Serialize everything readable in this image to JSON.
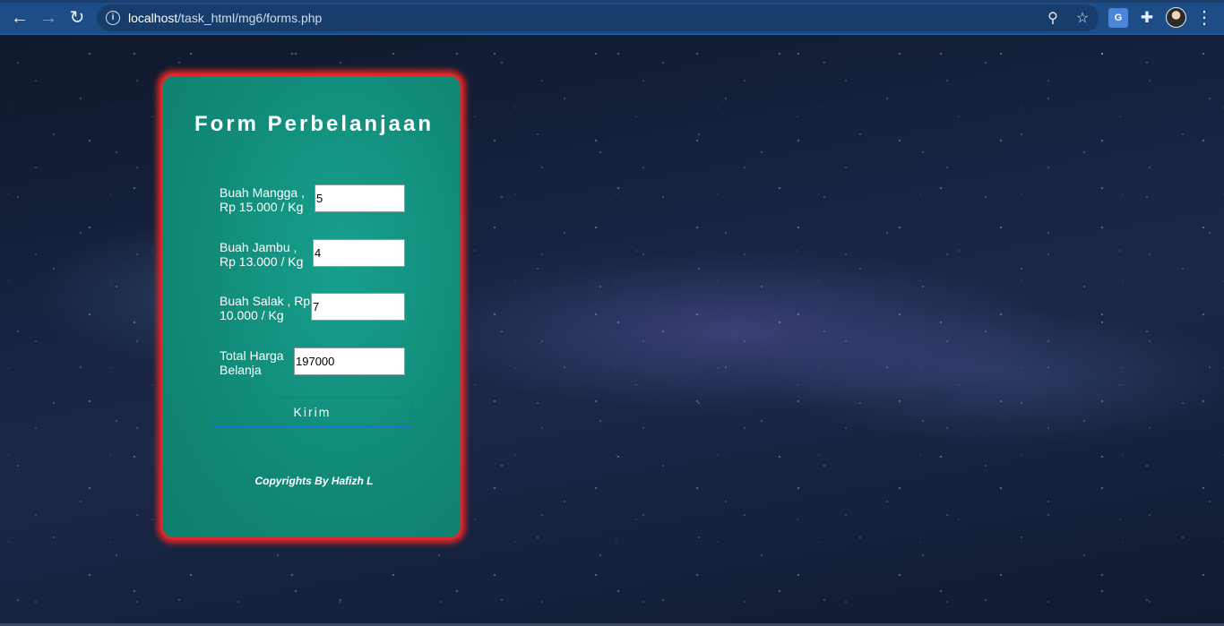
{
  "browser": {
    "back_icon": "←",
    "forward_icon": "→",
    "reload_icon": "↻",
    "info_icon": "i",
    "url_host": "localhost",
    "url_path": "/task_html/mg6/forms.php",
    "zoom_icon": "⚲",
    "star_icon": "☆",
    "translate_label": "G",
    "puzzle_icon": "✚",
    "menu_icon": "⋮"
  },
  "form": {
    "title": "Form Perbelanjaan",
    "fields": [
      {
        "label": "Buah Mangga , Rp 15.000 / Kg",
        "value": "5"
      },
      {
        "label": "Buah Jambu , Rp 13.000 / Kg",
        "value": "4"
      },
      {
        "label": "Buah Salak , Rp 10.000 / Kg",
        "value": "7"
      }
    ],
    "total_label": "Total Harga Belanja",
    "total_value": "197000",
    "submit_label": "Kirim",
    "copyright": "Copyrights By Hafizh L"
  },
  "colors": {
    "card_bg": "#118a78",
    "card_border": "#d92b2b",
    "chrome_bg": "#1c4d86",
    "button_border": "#1e6fd2"
  }
}
